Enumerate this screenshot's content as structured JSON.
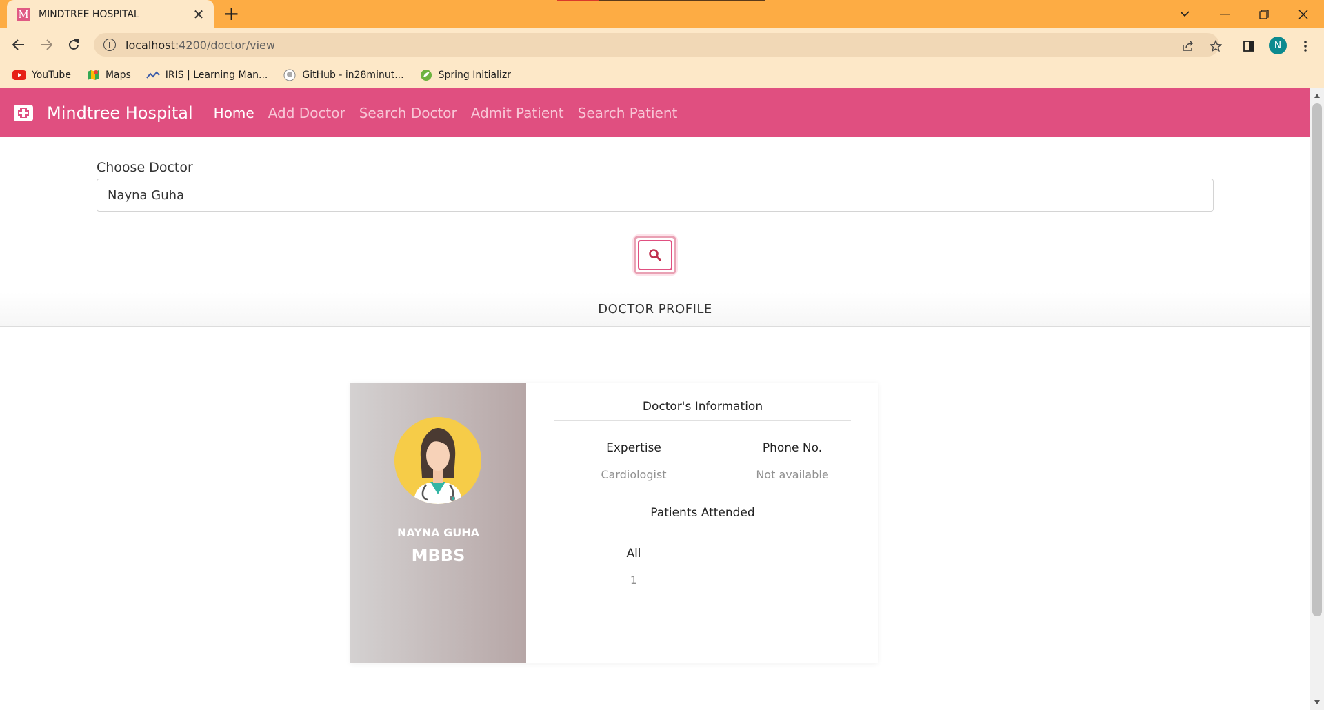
{
  "browser": {
    "tab_title": "MINDTREE HOSPITAL",
    "tab_favicon_letter": "M",
    "url_host": "localhost",
    "url_path": ":4200/doctor/view",
    "profile_initial": "N",
    "bookmarks": [
      {
        "label": "YouTube",
        "icon": "youtube-icon"
      },
      {
        "label": "Maps",
        "icon": "maps-icon"
      },
      {
        "label": "IRIS | Learning Man...",
        "icon": "iris-icon"
      },
      {
        "label": "GitHub - in28minut...",
        "icon": "github-icon"
      },
      {
        "label": "Spring Initializr",
        "icon": "spring-icon"
      }
    ]
  },
  "navbar": {
    "brand": "Mindtree Hospital",
    "links": [
      "Home",
      "Add Doctor",
      "Search Doctor",
      "Admit Patient",
      "Search Patient"
    ],
    "active_link": "Home",
    "color": "#e04f80"
  },
  "search": {
    "label": "Choose Doctor",
    "value": "Nayna Guha"
  },
  "profile": {
    "section_title": "DOCTOR PROFILE",
    "name": "NAYNA GUHA",
    "degree": "MBBS",
    "info_title": "Doctor's Information",
    "expertise_label": "Expertise",
    "expertise_value": "Cardiologist",
    "phone_label": "Phone No.",
    "phone_value": "Not available",
    "patients_title": "Patients Attended",
    "patients_label": "All",
    "patients_value": "1"
  }
}
